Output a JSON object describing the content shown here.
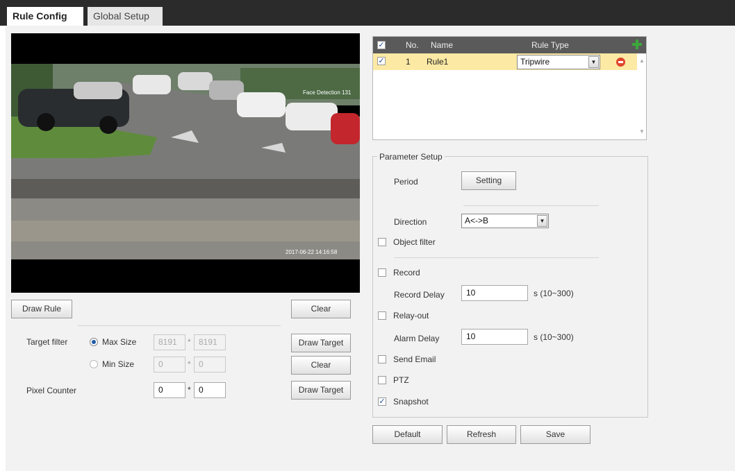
{
  "tabs": [
    {
      "label": "Rule Config",
      "active": true
    },
    {
      "label": "Global Setup",
      "active": false
    }
  ],
  "video": {
    "overlay_top_right": "Face Detection 131",
    "overlay_bottom_right": "2017-06-22 14:16:58"
  },
  "left": {
    "draw_rule": "Draw Rule",
    "clear": "Clear",
    "target_filter_label": "Target filter",
    "max_size_label": "Max Size",
    "max_size_w": "8191",
    "max_size_h": "8191",
    "min_size_label": "Min Size",
    "min_size_w": "0",
    "min_size_h": "0",
    "draw_target_1": "Draw Target",
    "clear_2": "Clear",
    "pixel_counter_label": "Pixel Counter",
    "pixel_w": "0",
    "pixel_h": "0",
    "draw_target_2": "Draw Target",
    "times": "*",
    "max_size_selected": true
  },
  "rule_table": {
    "headers": {
      "no": "No.",
      "name": "Name",
      "rule_type": "Rule Type"
    },
    "rows": [
      {
        "checked": true,
        "no": "1",
        "name": "Rule1",
        "rule_type": "Tripwire"
      }
    ]
  },
  "params": {
    "legend": "Parameter Setup",
    "period_label": "Period",
    "setting_btn": "Setting",
    "direction_label": "Direction",
    "direction_value": "A<->B",
    "object_filter": "Object filter",
    "record": "Record",
    "record_delay_label": "Record Delay",
    "record_delay_value": "10",
    "record_delay_range": "s (10~300)",
    "relay_out": "Relay-out",
    "alarm_delay_label": "Alarm Delay",
    "alarm_delay_value": "10",
    "alarm_delay_range": "s (10~300)",
    "send_email": "Send Email",
    "ptz": "PTZ",
    "snapshot": "Snapshot",
    "snapshot_checked": true
  },
  "footer": {
    "default": "Default",
    "refresh": "Refresh",
    "save": "Save"
  },
  "colors": {
    "accent_blue": "#1e5aa8",
    "row_highlight": "#fce9a4",
    "add_green": "#3ca83c",
    "remove_red": "#e0452b"
  }
}
